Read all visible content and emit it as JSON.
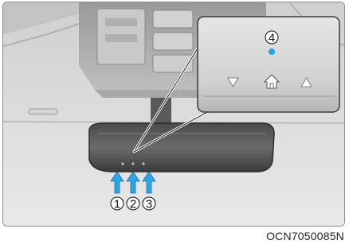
{
  "figure": {
    "caption_code": "OCN7050085N",
    "callouts": [
      {
        "label": "1",
        "part": "button"
      },
      {
        "label": "2",
        "part": "button"
      },
      {
        "label": "3",
        "part": "button"
      }
    ],
    "inset": {
      "indicator_label": "4",
      "indicator_color": "#1aa3e8",
      "icons": [
        "down-triangle-icon",
        "home-icon",
        "up-triangle-icon"
      ]
    },
    "arrow_color": "#2aa7e6"
  }
}
